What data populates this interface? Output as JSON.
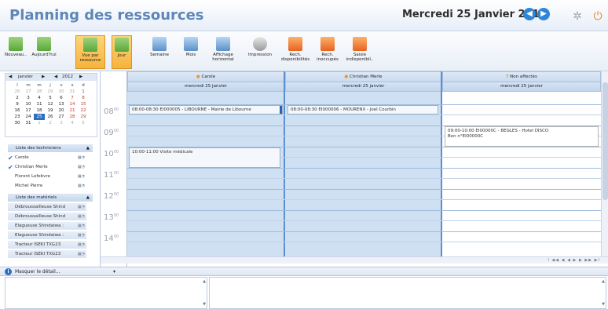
{
  "header": {
    "title": "Planning des ressources",
    "date": "Mercredi 25 Janvier 2012",
    "prev_glyph": "◀",
    "next_glyph": "▶"
  },
  "toolbar": [
    {
      "label": "Nouveau..",
      "icon": "new-event-icon",
      "color": "green",
      "active": false
    },
    {
      "label": "Aujourd'hui",
      "icon": "today-icon",
      "color": "green",
      "active": false
    },
    {
      "label": "Vue par ressource",
      "icon": "resource-view-icon",
      "color": "green",
      "active": true
    },
    {
      "label": "Jour",
      "icon": "day-view-icon",
      "color": "green",
      "active": true
    },
    {
      "label": "Semaine",
      "icon": "week-view-icon",
      "color": "blue",
      "active": false
    },
    {
      "label": "Mois",
      "icon": "month-view-icon",
      "color": "blue",
      "active": false
    },
    {
      "label": "Affichage horizontal",
      "icon": "horizontal-view-icon",
      "color": "blue",
      "active": false
    },
    {
      "label": "Impression",
      "icon": "print-icon",
      "color": "grey",
      "active": false
    },
    {
      "label": "Rech. disponibilités",
      "icon": "search-available-icon",
      "color": "orange",
      "active": false
    },
    {
      "label": "Rech. inoccupés",
      "icon": "search-unoccupied-icon",
      "color": "orange",
      "active": false
    },
    {
      "label": "Saisie indisponibil..",
      "icon": "unavailability-icon",
      "color": "orange",
      "active": false
    }
  ],
  "minical": {
    "month": "janvier",
    "year": "2012",
    "weekdays": [
      "l",
      "m",
      "m",
      "j",
      "v",
      "s",
      "d"
    ],
    "weeks": [
      [
        "26",
        "27",
        "28",
        "29",
        "30",
        "31",
        "1"
      ],
      [
        "2",
        "3",
        "4",
        "5",
        "6",
        "7",
        "8"
      ],
      [
        "9",
        "10",
        "11",
        "12",
        "13",
        "14",
        "15"
      ],
      [
        "16",
        "17",
        "18",
        "19",
        "20",
        "21",
        "22"
      ],
      [
        "23",
        "24",
        "25",
        "26",
        "27",
        "28",
        "29"
      ],
      [
        "30",
        "31",
        "1",
        "2",
        "3",
        "4",
        "5"
      ]
    ],
    "week_numbers": [
      "52",
      "1",
      "2",
      "3",
      "4",
      "5"
    ],
    "selected": "25"
  },
  "technicians": {
    "header": "Liste des techniciens",
    "items": [
      {
        "name": "Carole",
        "checked": true
      },
      {
        "name": "Christian Merle",
        "checked": true
      },
      {
        "name": "Florent Lefebvre",
        "checked": false
      },
      {
        "name": "Michel Pierre",
        "checked": false
      }
    ]
  },
  "materials": {
    "header": "Liste des matériels",
    "items": [
      "Débroussailleuse Shind",
      "Débroussailleuse Shind",
      "Elagueuse Shindaiwa :",
      "Elagueuse Shindaiwa :",
      "Tracteur ISEKI TXG23",
      "Tracteur ISEKI TXG23"
    ]
  },
  "times": [
    "08",
    "09",
    "10",
    "11",
    "12",
    "13",
    "14"
  ],
  "time_minutes": "00",
  "resources": [
    {
      "name": "Carole",
      "date": "mercredi 25 janvier",
      "icon": "person-icon"
    },
    {
      "name": "Christian Merle",
      "date": "mercredi 25 janvier",
      "icon": "person-icon"
    },
    {
      "name": "Non affectés",
      "date": "mercredi 25 janvier",
      "icon": "question-icon"
    }
  ],
  "events": [
    {
      "text": "08:00-08:30 EI000005 - LIBOURNE - Mairie de Libourne",
      "resource": 0
    },
    {
      "text": "08:00-08:30 EI000006 - MOURENX - Joel Courbin",
      "resource": 1
    },
    {
      "text": "10:00-11:00 Visite médicale",
      "resource": 0
    },
    {
      "text": "09:00-10:00 EI00000C - BEGLES - Hotel DISCO",
      "line2": "Bon n°EI00000C",
      "resource": 2
    }
  ],
  "scroll_nav": "I ◀◀ ◀ ◀ ▶ ▶ ▶▶ ▶I",
  "detail": {
    "label": "Masquer le détail...",
    "dropdown": "▾"
  }
}
